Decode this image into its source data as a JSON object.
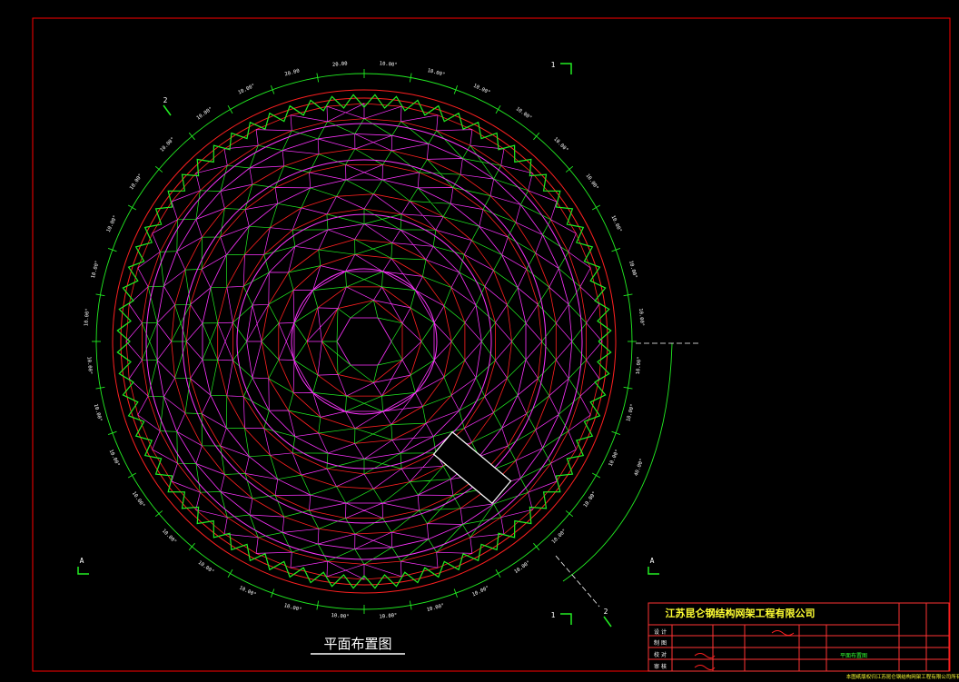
{
  "colors": {
    "background": "#000000",
    "frame": "#ff0000",
    "ring_red": "#ff2020",
    "green": "#22ee22",
    "magenta": "#ff33ff",
    "white": "#ffffff",
    "yellow": "#ffff33",
    "cyan": "#33ffff"
  },
  "drawing": {
    "title": "平面布置图",
    "section_markers": [
      "1",
      "1",
      "2",
      "2",
      "A",
      "A"
    ],
    "dimension_labels": [
      "10.00°",
      "10.00°",
      "10.00°",
      "10.00°",
      "10.00°",
      "10.00°",
      "10.00°",
      "10.00°",
      "10.00°",
      "10.00°",
      "10.00°",
      "10.00°",
      "10.00°",
      "10.00°",
      "10.00°",
      "10.00°",
      "10.00°",
      "10.00°",
      "10.00°",
      "10.00°",
      "10.00°",
      "10.00°",
      "10.00°",
      "10.00°",
      "10.00°",
      "10.00°",
      "10.00°",
      "10.00°",
      "10.00°",
      "10.00°",
      "10.00°",
      "10.00°",
      "10.00°",
      "10.00°",
      "20.00",
      "20.00",
      "40.00°"
    ],
    "ring_count": 14,
    "radial_count": 36
  },
  "title_block": {
    "company": "江苏昆仑钢结构网架工程有限公司",
    "row_labels": [
      "设 计",
      "制 图",
      "校 对",
      "审 核"
    ],
    "sheet_label": "平面布置图",
    "footer_note": "本图纸版权归江苏昆仑钢结构网架工程有限公司所有"
  }
}
